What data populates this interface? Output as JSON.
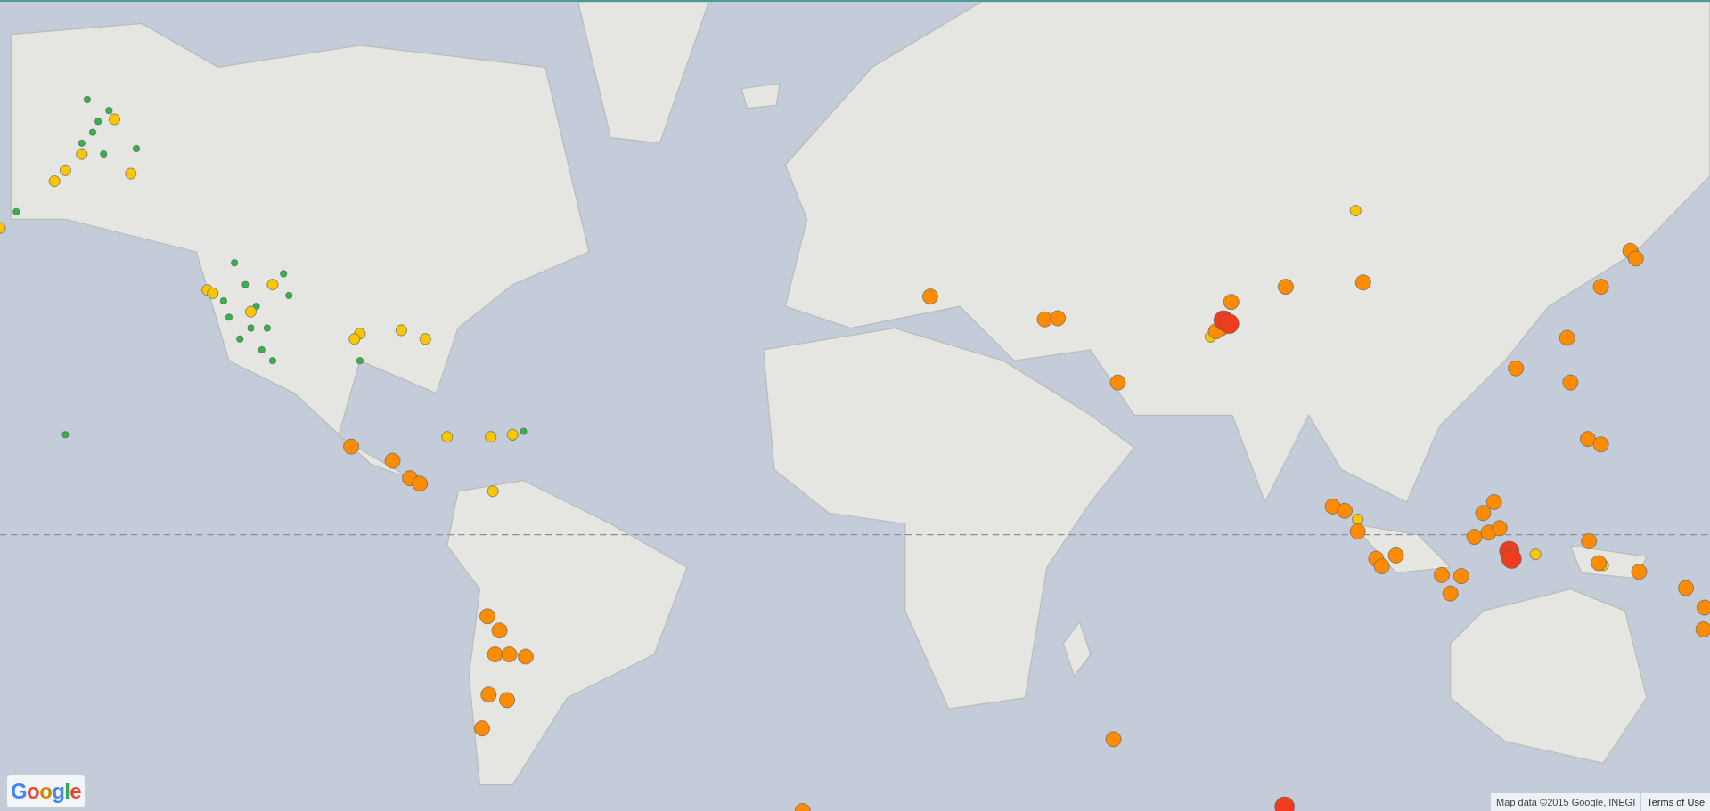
{
  "logo": {
    "text": "Google"
  },
  "attribution": {
    "text": "Map data ©2015 Google, INEGI"
  },
  "terms_link": {
    "text": "Terms of Use"
  }
}
